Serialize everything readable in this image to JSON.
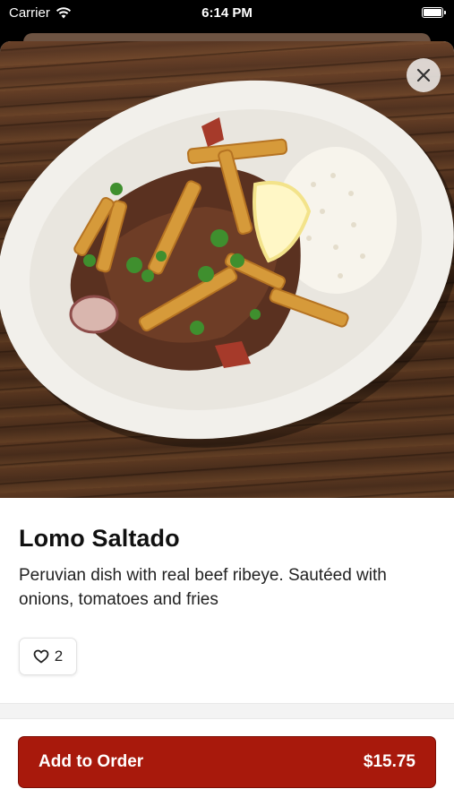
{
  "status_bar": {
    "carrier": "Carrier",
    "time": "6:14 PM"
  },
  "item": {
    "name": "Lomo Saltado",
    "description": "Peruvian dish with real beef ribeye. Sautéed with onions, tomatoes and fries",
    "likes": "2"
  },
  "order_button": {
    "label": "Add to Order",
    "price": "$15.75"
  },
  "colors": {
    "accent": "#a8190c",
    "background": "#ffffff"
  },
  "icons": {
    "close": "close-icon",
    "like": "heart-icon",
    "wifi": "wifi-icon",
    "battery": "battery-icon"
  }
}
